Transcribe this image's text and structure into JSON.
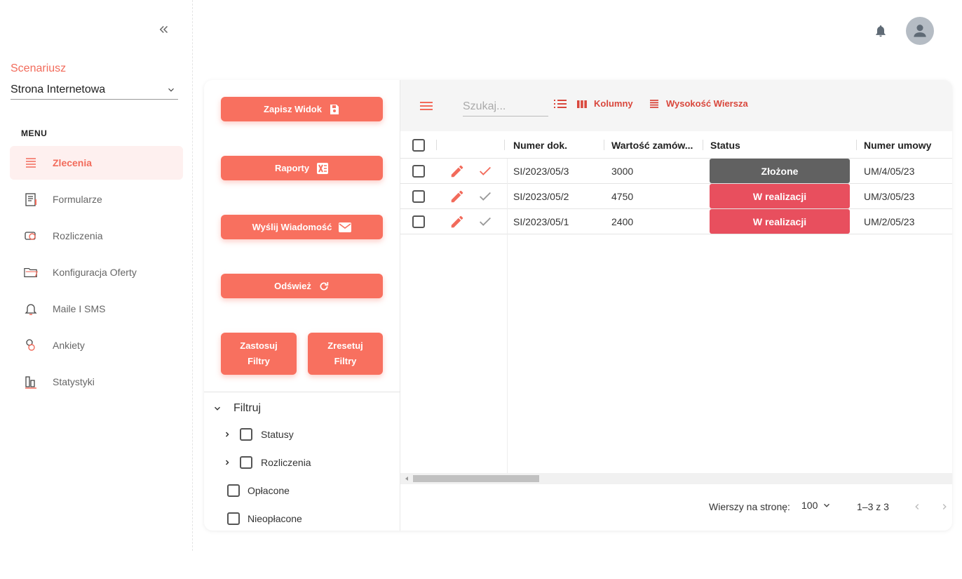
{
  "sidebar": {
    "scenario_label": "Scenariusz",
    "scenario_value": "Strona Internetowa",
    "menu_title": "MENU",
    "items": [
      {
        "label": "Zlecenia",
        "icon": "list-icon"
      },
      {
        "label": "Formularze",
        "icon": "clipboard-icon"
      },
      {
        "label": "Rozliczenia",
        "icon": "money-icon"
      },
      {
        "label": "Konfiguracja Oferty",
        "icon": "folder-icon"
      },
      {
        "label": "Maile I SMS",
        "icon": "bell-icon"
      },
      {
        "label": "Ankiety",
        "icon": "survey-icon"
      },
      {
        "label": "Statystyki",
        "icon": "chart-icon"
      }
    ]
  },
  "actions": {
    "save_view": "Zapisz Widok",
    "reports": "Raporty",
    "send_message": "Wyślij Wiadomość",
    "refresh": "Odśwież",
    "apply_filters": "Zastosuj Filtry",
    "reset_filters": "Zresetuj Filtry"
  },
  "filters": {
    "title": "Filtruj",
    "items": [
      "Statusy",
      "Rozliczenia",
      "Opłacone",
      "Nieopłacone"
    ]
  },
  "toolbar": {
    "search_placeholder": "Szukaj...",
    "columns": "Kolumny",
    "row_height": "Wysokość Wiersza"
  },
  "table": {
    "headers": [
      "Numer dok.",
      "Wartość zamów...",
      "Status",
      "Numer umowy"
    ],
    "rows": [
      {
        "doc": "SI/2023/05/3",
        "value": "3000",
        "status": "Złożone",
        "contract": "UM/4/05/23",
        "status_color": "#616161",
        "checked": true
      },
      {
        "doc": "SI/2023/05/2",
        "value": "4750",
        "status": "W realizacji",
        "contract": "UM/3/05/23",
        "status_color": "#e84f5e",
        "checked": false
      },
      {
        "doc": "SI/2023/05/1",
        "value": "2400",
        "status": "W realizacji",
        "contract": "UM/2/05/23",
        "status_color": "#e84f5e",
        "checked": false
      }
    ]
  },
  "pagination": {
    "rows_per_page_label": "Wierszy na stronę:",
    "rows_per_page": "100",
    "range": "1–3 z 3"
  },
  "colors": {
    "accent": "#f8705f",
    "accent_text": "#d9473c"
  }
}
